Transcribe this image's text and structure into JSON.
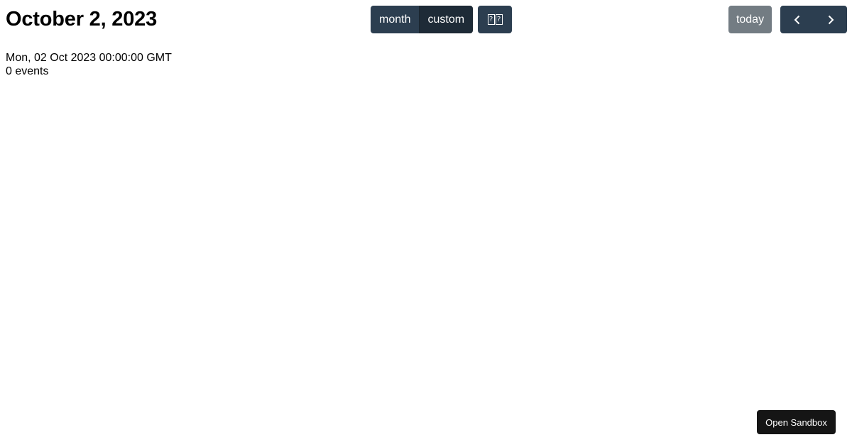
{
  "toolbar": {
    "title": "October 2, 2023",
    "views": [
      {
        "label": "month",
        "active": false
      },
      {
        "label": "custom",
        "active": true
      }
    ],
    "toggle_glyph": [
      "?",
      "?"
    ],
    "today_label": "today"
  },
  "info": {
    "date_string": "Mon, 02 Oct 2023 00:00:00 GMT",
    "event_count": "0 events"
  },
  "sandbox": {
    "label": "Open Sandbox"
  },
  "colors": {
    "button_primary": "#2c3e50",
    "button_active": "#1e2b37",
    "button_disabled": "#6c757d",
    "sandbox_button": "#151515"
  }
}
